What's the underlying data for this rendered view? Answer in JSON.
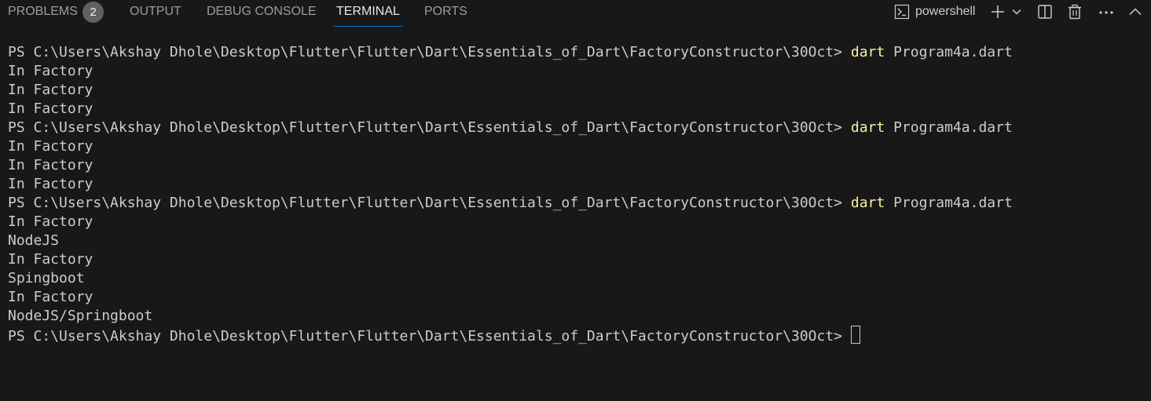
{
  "tabs": [
    {
      "label": "PROBLEMS",
      "badge": "2"
    },
    {
      "label": "OUTPUT"
    },
    {
      "label": "DEBUG CONSOLE"
    },
    {
      "label": "TERMINAL",
      "active": true
    },
    {
      "label": "PORTS"
    }
  ],
  "actions": {
    "shell_icon": "terminal-powershell-icon",
    "shell_label": "powershell",
    "add_icon": "plus-icon",
    "dropdown_icon": "chevron-down-icon",
    "split_icon": "split-terminal-icon",
    "trash_icon": "trash-icon",
    "more_icon": "ellipsis-icon",
    "maximize_icon": "chevron-up-icon"
  },
  "terminal": {
    "prompt": "PS C:\\Users\\Akshay Dhole\\Desktop\\Flutter\\Flutter\\Dart\\Essentials_of_Dart\\FactoryConstructor\\30Oct>",
    "command_keyword": "dart",
    "command_arg": "Program4a.dart",
    "lines": [
      {
        "type": "cmd"
      },
      {
        "type": "out",
        "text": "In Factory"
      },
      {
        "type": "out",
        "text": "In Factory"
      },
      {
        "type": "out",
        "text": "In Factory"
      },
      {
        "type": "cmd"
      },
      {
        "type": "out",
        "text": "In Factory"
      },
      {
        "type": "out",
        "text": "In Factory"
      },
      {
        "type": "out",
        "text": "In Factory"
      },
      {
        "type": "cmd"
      },
      {
        "type": "out",
        "text": "In Factory"
      },
      {
        "type": "out",
        "text": "NodeJS"
      },
      {
        "type": "out",
        "text": "In Factory"
      },
      {
        "type": "out",
        "text": "Spingboot"
      },
      {
        "type": "out",
        "text": "In Factory"
      },
      {
        "type": "out",
        "text": "NodeJS/Springboot"
      },
      {
        "type": "prompt"
      }
    ]
  },
  "colors": {
    "background": "#181818",
    "text": "#cccccc",
    "command": "#f9f1a5",
    "active_tab_underline": "#0078d4",
    "badge": "#616161"
  }
}
